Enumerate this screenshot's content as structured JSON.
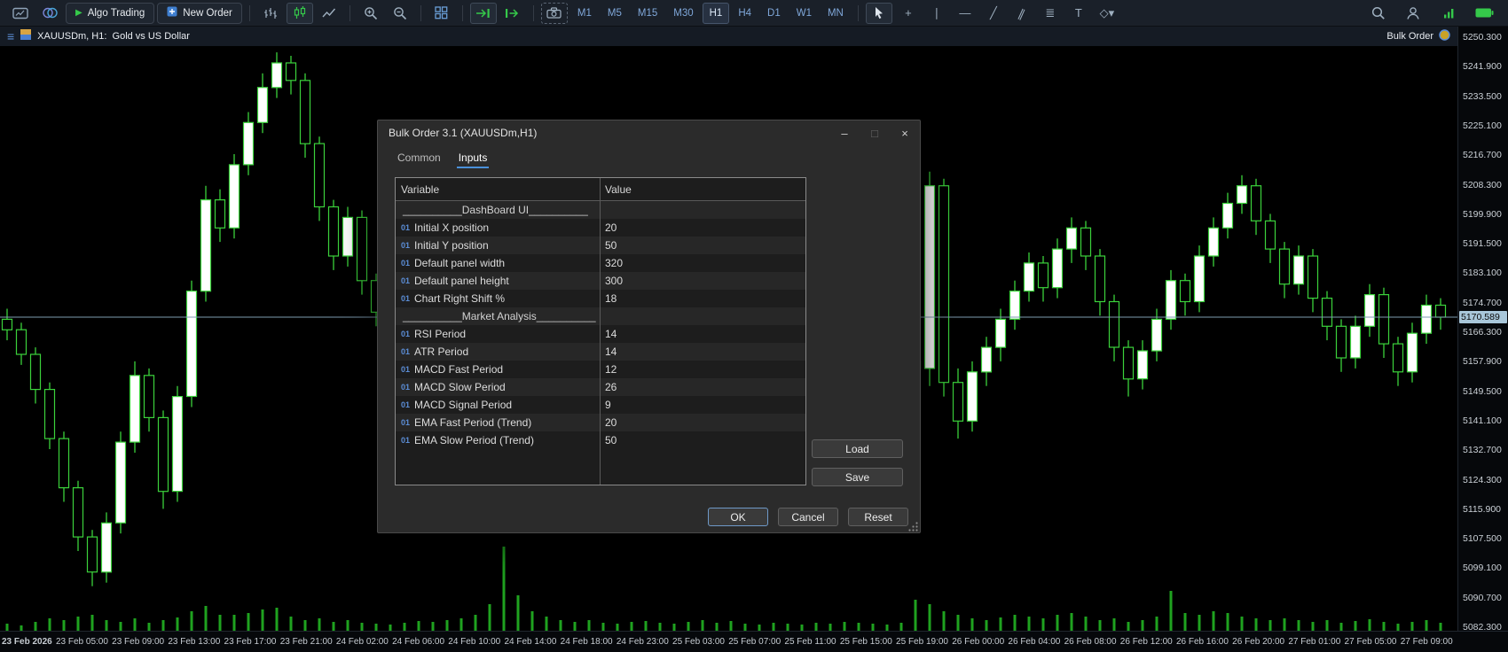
{
  "toolbar": {
    "algo_trading_label": "Algo Trading",
    "new_order_label": "New Order",
    "timeframes": [
      "M1",
      "M5",
      "M15",
      "M30",
      "H1",
      "H4",
      "D1",
      "W1",
      "MN"
    ],
    "active_timeframe": "H1",
    "draw_tools": [
      {
        "name": "crosshair-icon",
        "glyph": "+"
      },
      {
        "name": "vertical-line-icon",
        "glyph": "∣"
      },
      {
        "name": "horizontal-line-icon",
        "glyph": "―"
      },
      {
        "name": "trendline-icon",
        "glyph": "╱"
      },
      {
        "name": "channel-icon",
        "glyph": "∥"
      },
      {
        "name": "fibonacci-icon",
        "glyph": "≣"
      },
      {
        "name": "text-tool-icon",
        "glyph": "T"
      },
      {
        "name": "shapes-icon",
        "glyph": "◇▾"
      }
    ]
  },
  "chart": {
    "title": "XAUUSDm, H1:  Gold vs US Dollar",
    "overlay_label": "Bulk Order",
    "current_price": "5170.589",
    "price_labels": [
      "5250.300",
      "5241.900",
      "5233.500",
      "5225.100",
      "5216.700",
      "5208.300",
      "5199.900",
      "5191.500",
      "5183.100",
      "5174.700",
      "5166.300",
      "5157.900",
      "5149.500",
      "5141.100",
      "5132.700",
      "5124.300",
      "5115.900",
      "5107.500",
      "5099.100",
      "5090.700",
      "5082.300"
    ],
    "time_labels": [
      "23 Feb 2026",
      "23 Feb 05:00",
      "23 Feb 09:00",
      "23 Feb 13:00",
      "23 Feb 17:00",
      "23 Feb 21:00",
      "24 Feb 02:00",
      "24 Feb 06:00",
      "24 Feb 10:00",
      "24 Feb 14:00",
      "24 Feb 18:00",
      "24 Feb 23:00",
      "25 Feb 03:00",
      "25 Feb 07:00",
      "25 Feb 11:00",
      "25 Feb 15:00",
      "25 Feb 19:00",
      "26 Feb 00:00",
      "26 Feb 04:00",
      "26 Feb 08:00",
      "26 Feb 12:00",
      "26 Feb 16:00",
      "26 Feb 20:00",
      "27 Feb 01:00",
      "27 Feb 05:00",
      "27 Feb 09:00"
    ],
    "scale": {
      "price_top": 5253.33,
      "price_bottom": 5081.3
    },
    "colors": {
      "bull": "#ffffff",
      "bear": "#000000",
      "outline": "#3bd23b",
      "volume": "#1fa21f",
      "price_line": "#7e9bb0",
      "price_tag_bg": "#a9c7da"
    },
    "ohlc": [
      [
        5170,
        5173,
        5164,
        5167
      ],
      [
        5167,
        5169,
        5157,
        5160
      ],
      [
        5160,
        5162,
        5146,
        5150
      ],
      [
        5150,
        5152,
        5133,
        5136
      ],
      [
        5136,
        5138,
        5118,
        5122
      ],
      [
        5122,
        5124,
        5104,
        5108
      ],
      [
        5108,
        5110,
        5094,
        5098
      ],
      [
        5098,
        5115,
        5095,
        5112
      ],
      [
        5112,
        5138,
        5109,
        5135
      ],
      [
        5135,
        5158,
        5132,
        5154
      ],
      [
        5154,
        5156,
        5138,
        5142
      ],
      [
        5142,
        5144,
        5116,
        5121
      ],
      [
        5121,
        5151,
        5118,
        5148
      ],
      [
        5148,
        5181,
        5145,
        5178
      ],
      [
        5178,
        5208,
        5175,
        5204
      ],
      [
        5204,
        5207,
        5192,
        5196
      ],
      [
        5196,
        5217,
        5193,
        5214
      ],
      [
        5214,
        5229,
        5211,
        5226
      ],
      [
        5226,
        5240,
        5223,
        5236
      ],
      [
        5236,
        5246,
        5233,
        5243
      ],
      [
        5243,
        5245,
        5234,
        5238
      ],
      [
        5238,
        5240,
        5216,
        5220
      ],
      [
        5220,
        5222,
        5198,
        5202
      ],
      [
        5202,
        5204,
        5184,
        5188
      ],
      [
        5188,
        5202,
        5185,
        5199
      ],
      [
        5199,
        5201,
        5177,
        5181
      ],
      [
        5181,
        5183,
        5168,
        5172
      ],
      [
        5172,
        5174,
        5159,
        5163
      ],
      [
        5163,
        5165,
        5151,
        5155
      ],
      [
        5155,
        5157,
        5146,
        5150
      ],
      [
        5150,
        5161,
        5147,
        5158
      ],
      [
        5158,
        5168,
        5155,
        5165
      ],
      [
        5165,
        5167,
        5156,
        5160
      ],
      [
        5160,
        5162,
        5148,
        5152
      ],
      [
        5152,
        5154,
        5141,
        5145
      ],
      [
        5145,
        5154,
        5142,
        5151
      ],
      [
        5151,
        5161,
        5148,
        5158
      ],
      [
        5158,
        5168,
        5155,
        5165
      ],
      [
        5165,
        5167,
        5156,
        5160
      ],
      [
        5160,
        5173,
        5157,
        5170
      ],
      [
        5170,
        5181,
        5167,
        5178
      ],
      [
        5178,
        5186,
        5175,
        5183
      ],
      [
        5183,
        5185,
        5172,
        5176
      ],
      [
        5176,
        5178,
        5166,
        5170
      ],
      [
        5170,
        5172,
        5159,
        5163
      ],
      [
        5163,
        5165,
        5153,
        5157
      ],
      [
        5157,
        5159,
        5146,
        5150
      ],
      [
        5150,
        5161,
        5147,
        5158
      ],
      [
        5158,
        5167,
        5155,
        5164
      ],
      [
        5164,
        5174,
        5161,
        5171
      ],
      [
        5171,
        5180,
        5168,
        5177
      ],
      [
        5177,
        5185,
        5174,
        5182
      ],
      [
        5182,
        5184,
        5171,
        5175
      ],
      [
        5175,
        5177,
        5164,
        5168
      ],
      [
        5168,
        5177,
        5165,
        5174
      ],
      [
        5174,
        5176,
        5164,
        5168
      ],
      [
        5168,
        5170,
        5157,
        5161
      ],
      [
        5161,
        5163,
        5151,
        5155
      ],
      [
        5155,
        5163,
        5152,
        5160
      ],
      [
        5160,
        5169,
        5157,
        5166
      ],
      [
        5166,
        5168,
        5154,
        5158
      ],
      [
        5158,
        5166,
        5154,
        5163
      ],
      [
        5163,
        5165,
        5156,
        5160
      ],
      [
        5160,
        5162,
        5154,
        5158
      ],
      [
        5158,
        5163,
        5152,
        5156
      ],
      [
        5156,
        5212,
        5151,
        5208
      ],
      [
        5208,
        5210,
        5148,
        5152
      ],
      [
        5152,
        5156,
        5136,
        5141
      ],
      [
        5141,
        5158,
        5138,
        5155
      ],
      [
        5155,
        5165,
        5151,
        5162
      ],
      [
        5162,
        5173,
        5158,
        5170
      ],
      [
        5170,
        5181,
        5167,
        5178
      ],
      [
        5178,
        5189,
        5175,
        5186
      ],
      [
        5186,
        5188,
        5175,
        5179
      ],
      [
        5179,
        5193,
        5176,
        5190
      ],
      [
        5190,
        5199,
        5186,
        5196
      ],
      [
        5196,
        5198,
        5184,
        5188
      ],
      [
        5188,
        5190,
        5171,
        5175
      ],
      [
        5175,
        5177,
        5158,
        5162
      ],
      [
        5162,
        5164,
        5148,
        5153
      ],
      [
        5153,
        5164,
        5150,
        5161
      ],
      [
        5161,
        5173,
        5158,
        5170
      ],
      [
        5170,
        5184,
        5167,
        5181
      ],
      [
        5181,
        5183,
        5171,
        5175
      ],
      [
        5175,
        5191,
        5172,
        5188
      ],
      [
        5188,
        5199,
        5185,
        5196
      ],
      [
        5196,
        5206,
        5193,
        5203
      ],
      [
        5203,
        5211,
        5200,
        5208
      ],
      [
        5208,
        5210,
        5194,
        5198
      ],
      [
        5198,
        5200,
        5186,
        5190
      ],
      [
        5190,
        5192,
        5176,
        5180
      ],
      [
        5180,
        5191,
        5177,
        5188
      ],
      [
        5188,
        5190,
        5172,
        5176
      ],
      [
        5176,
        5178,
        5164,
        5168
      ],
      [
        5168,
        5170,
        5155,
        5159
      ],
      [
        5159,
        5171,
        5156,
        5168
      ],
      [
        5168,
        5180,
        5165,
        5177
      ],
      [
        5177,
        5179,
        5159,
        5163
      ],
      [
        5163,
        5165,
        5151,
        5155
      ],
      [
        5155,
        5169,
        5152,
        5166
      ],
      [
        5166,
        5177,
        5163,
        5174
      ],
      [
        5174,
        5176,
        5167,
        5170.6
      ]
    ],
    "volumes": [
      8,
      6,
      10,
      14,
      12,
      16,
      18,
      12,
      10,
      14,
      9,
      12,
      15,
      22,
      28,
      18,
      18,
      20,
      24,
      26,
      16,
      12,
      14,
      10,
      12,
      9,
      8,
      7,
      9,
      11,
      10,
      12,
      14,
      18,
      30,
      95,
      40,
      22,
      16,
      12,
      10,
      12,
      9,
      8,
      10,
      11,
      9,
      8,
      10,
      12,
      9,
      11,
      8,
      7,
      9,
      8,
      7,
      9,
      8,
      10,
      9,
      8,
      7,
      9,
      35,
      30,
      22,
      18,
      14,
      12,
      15,
      18,
      16,
      14,
      18,
      20,
      16,
      12,
      14,
      10,
      12,
      16,
      45,
      20,
      18,
      22,
      20,
      16,
      14,
      12,
      14,
      12,
      10,
      12,
      9,
      11,
      13,
      10,
      8,
      10,
      12,
      9
    ]
  },
  "dialog": {
    "title": "Bulk Order 3.1 (XAUUSDm,H1)",
    "tabs": [
      "Common",
      "Inputs"
    ],
    "active_tab": "Inputs",
    "table": {
      "headers": [
        "Variable",
        "Value"
      ],
      "rows": [
        {
          "type": "section",
          "name": "__________DashBoard UI__________",
          "value": ""
        },
        {
          "type": "param",
          "icon": "01",
          "name": "Initial X position",
          "value": "20"
        },
        {
          "type": "param",
          "icon": "01",
          "name": "Initial Y position",
          "value": "50"
        },
        {
          "type": "param",
          "icon": "01",
          "name": "Default panel width",
          "value": "320"
        },
        {
          "type": "param",
          "icon": "01",
          "name": "Default panel height",
          "value": "300"
        },
        {
          "type": "param",
          "icon": "01",
          "name": "Chart Right Shift %",
          "value": "18"
        },
        {
          "type": "section",
          "name": "__________Market Analysis__________",
          "value": ""
        },
        {
          "type": "param",
          "icon": "01",
          "name": "RSI Period",
          "value": "14"
        },
        {
          "type": "param",
          "icon": "01",
          "name": "ATR Period",
          "value": "14"
        },
        {
          "type": "param",
          "icon": "01",
          "name": "MACD Fast Period",
          "value": "12"
        },
        {
          "type": "param",
          "icon": "01",
          "name": "MACD Slow Period",
          "value": "26"
        },
        {
          "type": "param",
          "icon": "01",
          "name": "MACD Signal Period",
          "value": "9"
        },
        {
          "type": "param",
          "icon": "01",
          "name": "EMA Fast Period (Trend)",
          "value": "20"
        },
        {
          "type": "param",
          "icon": "01",
          "name": "EMA Slow Period (Trend)",
          "value": "50"
        }
      ]
    },
    "buttons": {
      "load": "Load",
      "save": "Save",
      "ok": "OK",
      "cancel": "Cancel",
      "reset": "Reset"
    }
  }
}
